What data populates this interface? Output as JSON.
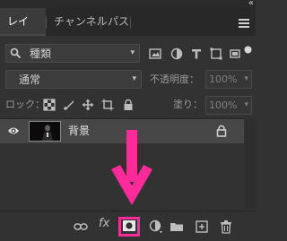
{
  "tabs": [
    {
      "label": "レイヤー",
      "active": true
    },
    {
      "label": "チャンネル",
      "active": false
    },
    {
      "label": "パス",
      "active": false
    }
  ],
  "filter": {
    "kind_label": "種類"
  },
  "blend": {
    "mode": "通常",
    "opacity_label": "不透明度：",
    "opacity_value": "100%"
  },
  "lock_row": {
    "label": "ロック：",
    "fill_label": "塗り：",
    "fill_value": "100%"
  },
  "layers": [
    {
      "name": "背景",
      "visible": true,
      "locked": true
    }
  ],
  "colors": {
    "accent": "#ff2a9a",
    "panel_bg": "#323232",
    "selected_row": "#474747"
  },
  "bottom_icons": [
    "link-icon",
    "fx-icon",
    "layer-mask-icon",
    "adjustment-layer-icon",
    "group-folder-icon",
    "new-layer-icon",
    "trash-icon"
  ],
  "highlighted": "layer-mask-icon"
}
